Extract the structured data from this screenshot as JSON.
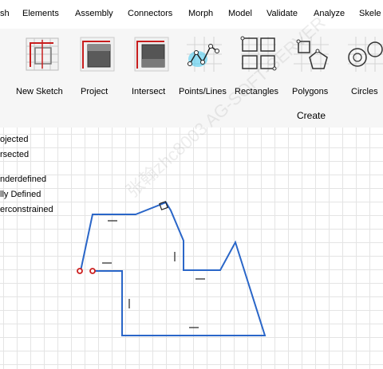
{
  "menu": {
    "items": [
      "sh",
      "Elements",
      "Assembly",
      "Connectors",
      "Morph",
      "Model",
      "Validate",
      "Analyze",
      "Skele"
    ]
  },
  "ribbon": {
    "tools": [
      {
        "label": "New Sketch",
        "icon": "new-sketch-icon"
      },
      {
        "label": "Project",
        "icon": "project-icon"
      },
      {
        "label": "Intersect",
        "icon": "intersect-icon"
      },
      {
        "label": "Points/Lines",
        "icon": "points-lines-icon"
      },
      {
        "label": "Rectangles",
        "icon": "rectangles-icon"
      },
      {
        "label": "Polygons",
        "icon": "polygons-icon"
      },
      {
        "label": "Circles",
        "icon": "circles-icon"
      }
    ],
    "group_label": "Create"
  },
  "legend": {
    "items": [
      "ojected",
      "rsected",
      "nderdefined",
      "lly Defined",
      "erconstrained"
    ]
  },
  "watermark": "张翰zhc8003 AG-SOFT-SERVER",
  "colors": {
    "sketch_line": "#2a66c8",
    "point_marker": "#cc1f1f",
    "grid": "#e4e4e4",
    "ribbon_bg": "#f6f6f6"
  }
}
